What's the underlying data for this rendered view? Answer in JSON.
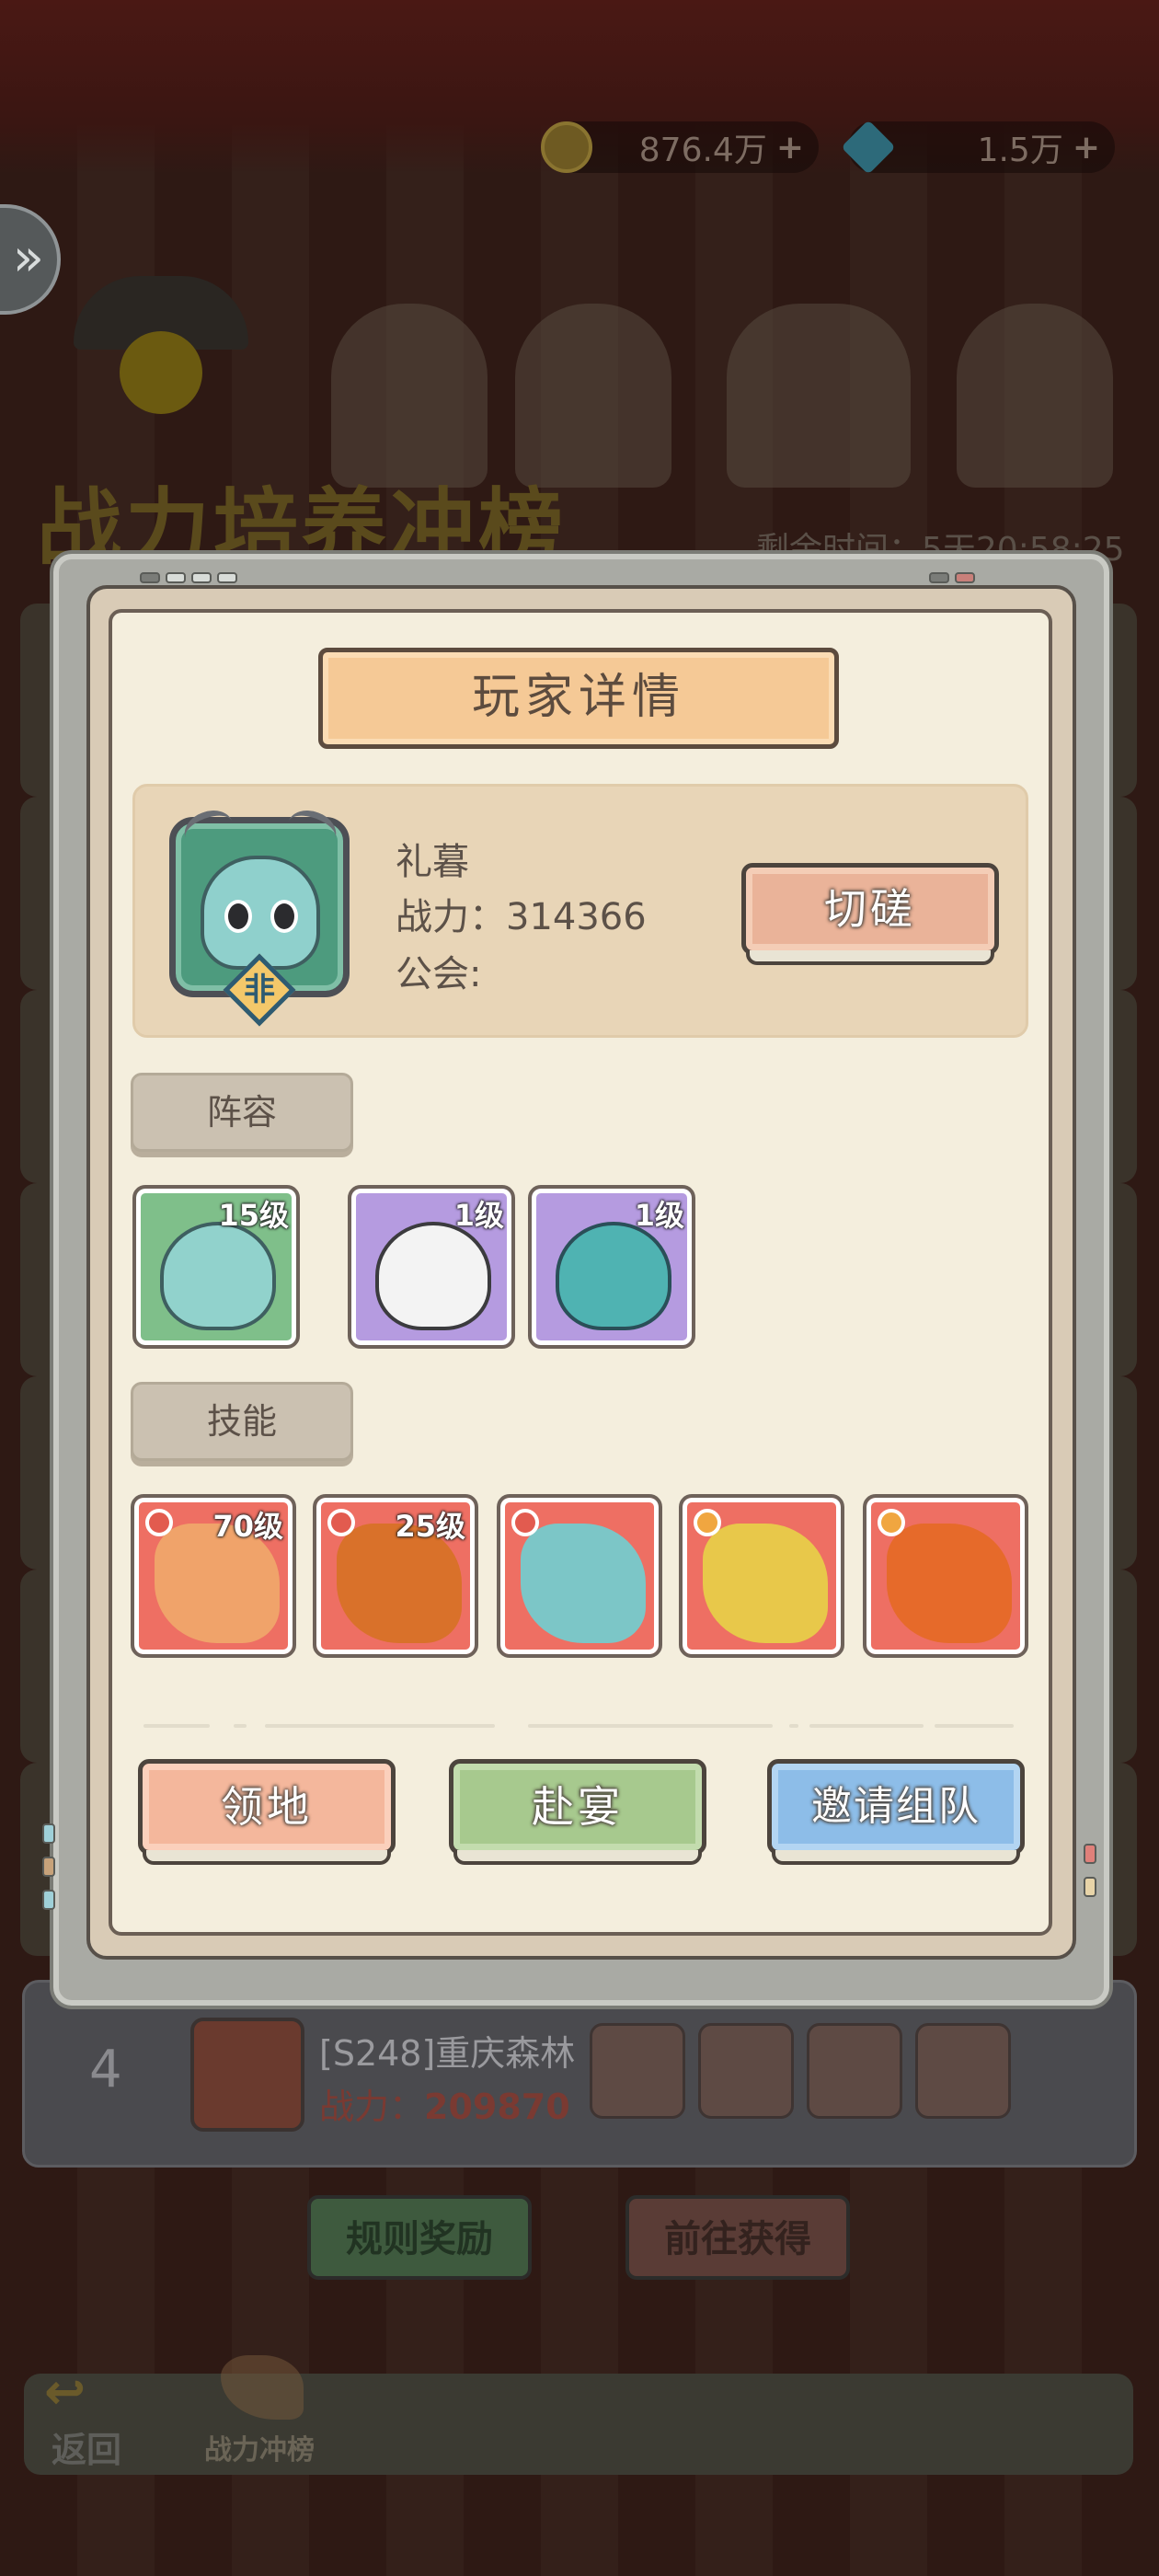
{
  "currency": {
    "gold_value": "876.4万",
    "gem_value": "1.5万",
    "plus_symbol": "+"
  },
  "background": {
    "event_title": "战力培养冲榜",
    "timer_text": "剩余时间：5天20:58:25",
    "expand_symbol": "»",
    "rank_entry": {
      "rank": "4",
      "name": "[S248]重庆森林",
      "power_label": "战力：",
      "power_value": "209870"
    },
    "rules_button": "规则奖励",
    "goto_button": "前往获得",
    "back_label": "返回",
    "back_arrow": "↩",
    "rank_tab_label": "战力冲榜"
  },
  "modal": {
    "title": "玩家详情",
    "player": {
      "name": "礼暮",
      "power": "战力：314366",
      "guild": "公会:",
      "badge_char": "非"
    },
    "spar_button": "切磋",
    "lineup_label": "阵容",
    "lineup": [
      {
        "level": "15级"
      },
      {
        "level": "1级"
      },
      {
        "level": "1级"
      }
    ],
    "skills_label": "技能",
    "skills": [
      {
        "level": "70级"
      },
      {
        "level": "25级"
      },
      {
        "level": ""
      },
      {
        "level": ""
      },
      {
        "level": ""
      }
    ],
    "buttons": {
      "territory": "领地",
      "feast": "赴宴",
      "invite": "邀请组队"
    }
  },
  "colors": {
    "panel": "#f4eedd",
    "banner": "#f5c996",
    "spar_button": "#eab399",
    "feast_button": "#a7c98e",
    "invite_button": "#8dbde8",
    "skill_card": "#ee6f63"
  }
}
